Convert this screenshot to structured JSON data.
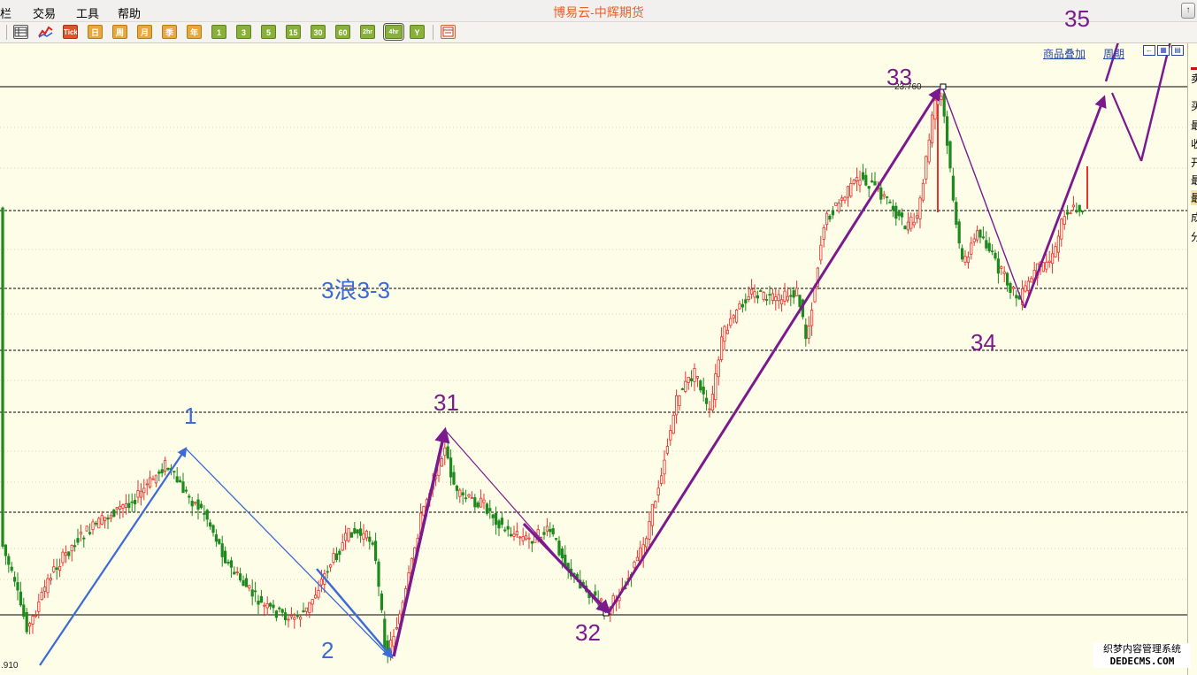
{
  "menubar": {
    "items": [
      "栏",
      "交易",
      "工具",
      "帮助"
    ],
    "title": "博易云-中辉期货"
  },
  "toolbar": {
    "buttons": [
      "Tick",
      "日",
      "周",
      "月",
      "季",
      "年",
      "1",
      "3",
      "5",
      "15",
      "30",
      "60",
      "2hr",
      "4hr",
      "Y"
    ],
    "selected": "4hr"
  },
  "chart_toolbar": {
    "overlay_link": "商品叠加",
    "period_link": "周期"
  },
  "right_panel": {
    "chars": [
      "卖",
      "买",
      "最",
      "收",
      "开",
      "最",
      "最",
      "成",
      "分"
    ]
  },
  "price_labels": {
    "high": "23.760",
    "low": ".910"
  },
  "annotations": {
    "wave_title": "3浪3-3",
    "points": [
      "1",
      "2",
      "31",
      "32",
      "33",
      "34",
      "35"
    ]
  },
  "colors": {
    "up": "#e8322e",
    "down": "#1d8a1d",
    "blue": "#3c6ad6",
    "purple": "#7a1a8e",
    "bg": "#fefde8"
  },
  "watermark": {
    "line1": "织梦内容管理系统",
    "line2": "DEDECMS.COM"
  }
}
